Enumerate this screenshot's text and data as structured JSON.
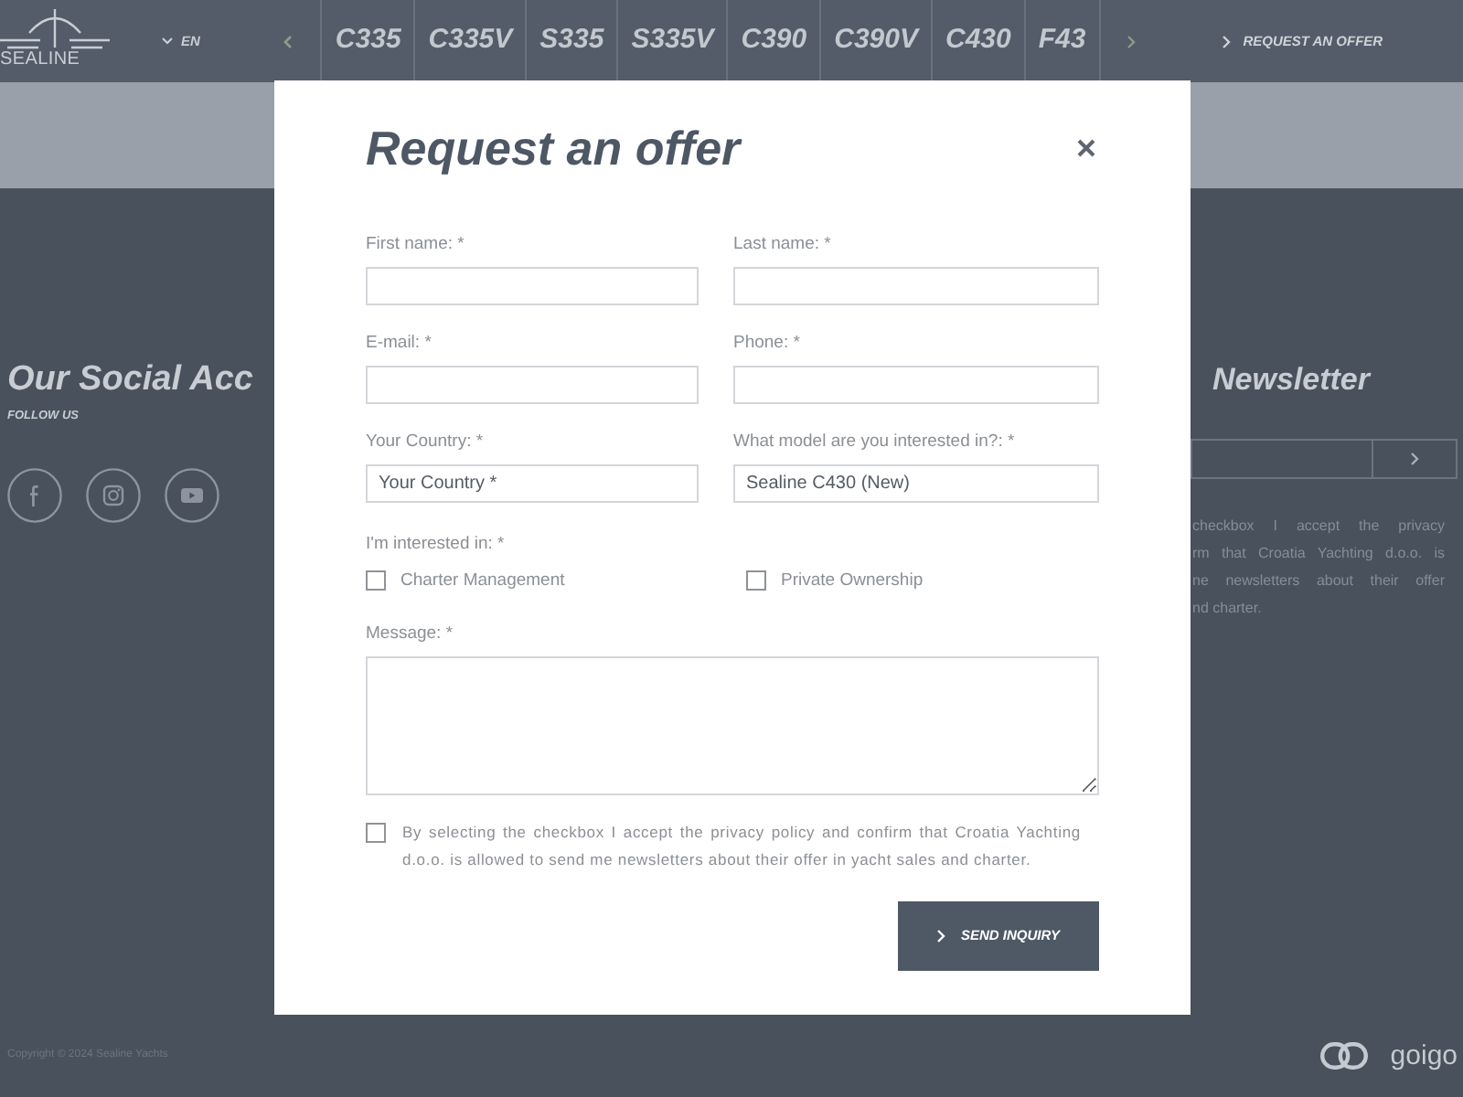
{
  "header": {
    "logo": "SEALINE",
    "language": "EN",
    "models": [
      "C335",
      "C335V",
      "S335",
      "S335V",
      "C390",
      "C390V",
      "C430",
      "F43"
    ],
    "request_link": "REQUEST AN OFFER"
  },
  "social": {
    "title": "Our Social Acc",
    "subtitle": "FOLLOW US"
  },
  "newsletter": {
    "title": "Newsletter",
    "consent_lines": [
      {
        "text": "checkbox I accept the",
        "link": "privacy"
      },
      {
        "text": "rm that Croatia Yachting d.o.o. is"
      },
      {
        "text": "ne newsletters about their offer"
      },
      {
        "text": "nd charter."
      }
    ]
  },
  "modal": {
    "title": "Request an offer",
    "fields": [
      {
        "label": "First name: *"
      },
      {
        "label": "Last name: *"
      },
      {
        "label": "E-mail: *"
      },
      {
        "label": "Phone: *"
      },
      {
        "label": "Your Country: *",
        "value": "Your Country *"
      },
      {
        "label": "What model are you interested in?: *",
        "value": "Sealine C430 (New)"
      }
    ],
    "interests": {
      "label": "I'm interested in: *",
      "options": [
        {
          "label": "Charter Management",
          "checked": false
        },
        {
          "label": "Private Ownership",
          "checked": false
        }
      ]
    },
    "message": {
      "label": "Message: *"
    },
    "consent": {
      "checked": false,
      "before": "By selecting the checkbox I accept the",
      "link": "privacy policy",
      "after": "and confirm that Croatia Yachting d.o.o. is allowed to send me newsletters about their offer in yacht sales and charter."
    },
    "button": "SEND INQUIRY"
  },
  "footer": {
    "copyright": "Copyright © 2024 Sealine Yachts",
    "brand": "goigo"
  }
}
